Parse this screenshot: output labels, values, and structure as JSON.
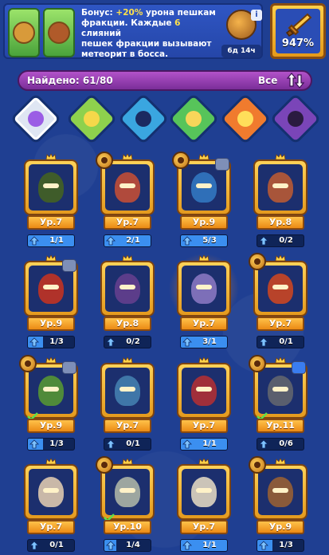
{
  "banner": {
    "line1_a": "Бонус: ",
    "line1_b": "+20%",
    "line1_c": " урона пешкам",
    "line2": "фракции. Каждые ",
    "line2_n": "6",
    "line2_b": " слияний",
    "line3": "пешек фракции вызывают",
    "line4": "метеорит в босса.",
    "timer": "6д 14ч",
    "info": "i",
    "faction_colors": [
      "#7bd04a",
      "#5fb83e"
    ]
  },
  "damage": {
    "value": "947%",
    "icon": "sword-icon"
  },
  "found": {
    "label": "Найдено: 61/80",
    "filter": "Все",
    "sort_icon": "sort-arrows-icon"
  },
  "tabs": [
    {
      "name": "all-factions",
      "color": "#dfe6f3",
      "gem": "#9b5de5"
    },
    {
      "name": "nature",
      "color": "#8ed14d",
      "gem": "#f5d84a"
    },
    {
      "name": "water",
      "color": "#3aa6e0",
      "gem": "#1b2a60"
    },
    {
      "name": "light",
      "color": "#57c45a",
      "gem": "#f7d65a"
    },
    {
      "name": "fire",
      "color": "#f07b2e",
      "gem": "#ffde5a"
    },
    {
      "name": "dark",
      "color": "#7a45b8",
      "gem": "#2a1b40"
    }
  ],
  "heroes": [
    {
      "level": "Ур.7",
      "progress": "1/1",
      "fill": 1.0,
      "color": "#3f5c2a",
      "rune": false,
      "up": false,
      "check": false
    },
    {
      "level": "Ур.7",
      "progress": "2/1",
      "fill": 1.0,
      "color": "#b04a3c",
      "rune": true,
      "up": false,
      "check": false
    },
    {
      "level": "Ур.9",
      "progress": "5/3",
      "fill": 1.0,
      "color": "#2f6fb8",
      "rune": true,
      "up": true,
      "check": false
    },
    {
      "level": "Ур.8",
      "progress": "0/2",
      "fill": 0.0,
      "color": "#a8553a",
      "rune": false,
      "up": false,
      "check": false
    },
    {
      "level": "Ур.9",
      "progress": "1/3",
      "fill": 0.33,
      "color": "#b0322a",
      "rune": false,
      "up": true,
      "check": false
    },
    {
      "level": "Ур.8",
      "progress": "0/2",
      "fill": 0.0,
      "color": "#5c3d8a",
      "rune": false,
      "up": false,
      "check": false
    },
    {
      "level": "Ур.7",
      "progress": "3/1",
      "fill": 1.0,
      "color": "#7d6fb8",
      "rune": false,
      "up": false,
      "check": false
    },
    {
      "level": "Ур.7",
      "progress": "0/1",
      "fill": 0.0,
      "color": "#b8432a",
      "rune": true,
      "up": false,
      "check": false
    },
    {
      "level": "Ур.9",
      "progress": "1/3",
      "fill": 0.33,
      "color": "#4f8a3a",
      "rune": true,
      "up": true,
      "check": true
    },
    {
      "level": "Ур.7",
      "progress": "0/1",
      "fill": 0.0,
      "color": "#3f76a8",
      "rune": false,
      "up": false,
      "check": false
    },
    {
      "level": "Ур.7",
      "progress": "1/1",
      "fill": 1.0,
      "color": "#a02f3a",
      "rune": false,
      "up": false,
      "check": false
    },
    {
      "level": "Ур.11",
      "progress": "0/6",
      "fill": 0.0,
      "color": "#5a5f6e",
      "rune": true,
      "up": true,
      "check": true
    },
    {
      "level": "Ур.7",
      "progress": "0/1",
      "fill": 0.0,
      "color": "#c9b8a8",
      "rune": false,
      "up": false,
      "check": false
    },
    {
      "level": "Ур.10",
      "progress": "1/4",
      "fill": 0.25,
      "color": "#9da6a0",
      "rune": true,
      "up": false,
      "check": true
    },
    {
      "level": "Ур.7",
      "progress": "1/1",
      "fill": 1.0,
      "color": "#cbc4b8",
      "rune": false,
      "up": false,
      "check": false
    },
    {
      "level": "Ур.9",
      "progress": "1/3",
      "fill": 0.33,
      "color": "#8a5a3a",
      "rune": true,
      "up": false,
      "check": false
    }
  ],
  "selected_index": 6
}
